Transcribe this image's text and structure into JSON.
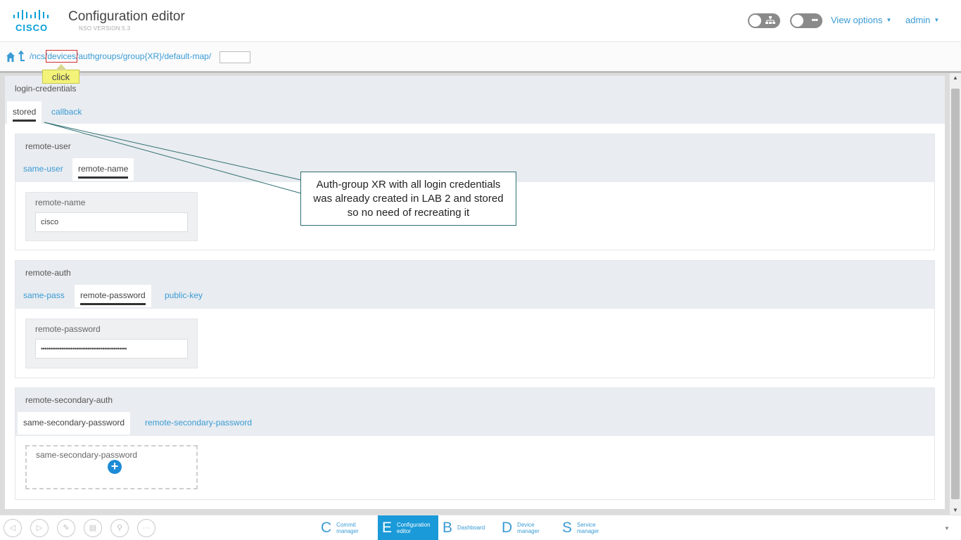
{
  "header": {
    "logo_text": "CISCO",
    "title": "Configuration editor",
    "version": "NSO VERSION:5.3",
    "toggle_1_icon": "sitemap-icon",
    "toggle_2_icon": "more-icon",
    "view_options": "View options",
    "user": "admin"
  },
  "breadcrumb": {
    "seg_ncs": "/ncs",
    "seg_sep": "/",
    "seg_devices": "devices",
    "seg_rest": "/authgroups/group{XR}/default-map/",
    "input_value": "",
    "tooltip": "click"
  },
  "login": {
    "title": "login-credentials",
    "tabs": [
      {
        "label": "stored",
        "active": true
      },
      {
        "label": "callback",
        "active": false
      }
    ]
  },
  "remote_user": {
    "title": "remote-user",
    "tabs": [
      {
        "label": "same-user",
        "active": false
      },
      {
        "label": "remote-name",
        "active": true
      }
    ],
    "leaf_label": "remote-name",
    "leaf_value": "cisco"
  },
  "remote_auth": {
    "title": "remote-auth",
    "tabs": [
      {
        "label": "same-pass",
        "active": false
      },
      {
        "label": "remote-password",
        "active": true
      },
      {
        "label": "public-key",
        "active": false
      }
    ],
    "leaf_label": "remote-password",
    "leaf_value": "••••••••••••••••••••••••••••••••••••••••••••••"
  },
  "remote_secondary": {
    "title": "remote-secondary-auth",
    "tabs": [
      {
        "label": "same-secondary-password",
        "active": true
      },
      {
        "label": "remote-secondary-password",
        "active": false
      }
    ],
    "leaf_label": "same-secondary-password",
    "add_icon": "plus-circle-icon"
  },
  "callout": {
    "line1": "Auth-group XR with all login credentials",
    "line2": "was already created in LAB 2 and stored",
    "line3": "so no need of recreating it"
  },
  "footer": {
    "apps": [
      {
        "letter": "C",
        "line1": "Commit",
        "line2": "manager",
        "active": false
      },
      {
        "letter": "E",
        "line1": "Configuration",
        "line2": "editor",
        "active": true
      },
      {
        "letter": "B",
        "line1": "Dashboard",
        "line2": "",
        "active": false
      },
      {
        "letter": "D",
        "line1": "Device",
        "line2": "manager",
        "active": false
      },
      {
        "letter": "S",
        "line1": "Service",
        "line2": "manager",
        "active": false
      }
    ]
  },
  "colors": {
    "accent": "#3a9bd5",
    "active_app": "#1a9ad8",
    "panel_head": "#e9ecf0",
    "highlight_box": "#d32f2f",
    "tooltip_bg": "#f3f37a"
  }
}
